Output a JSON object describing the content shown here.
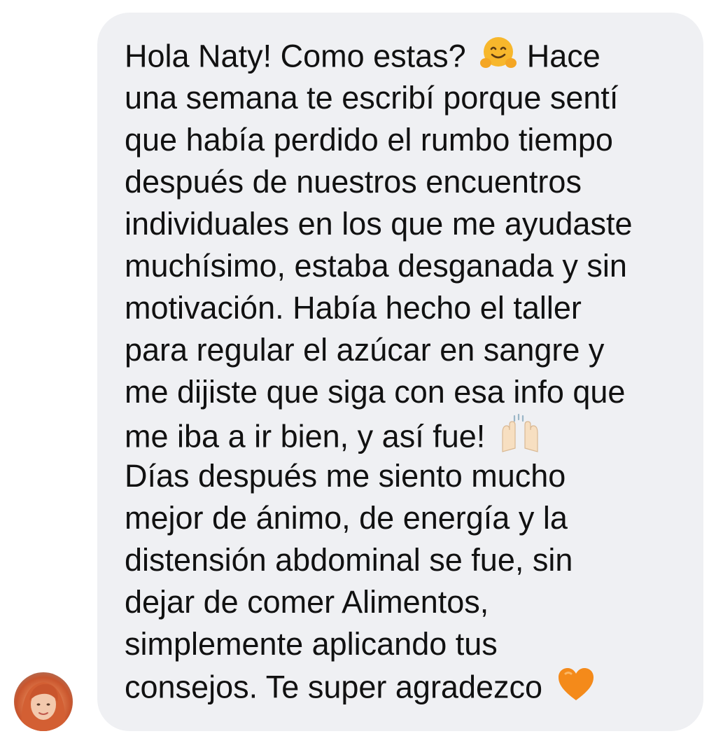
{
  "message": {
    "lines": [
      "Hola Naty! Como estas?",
      "una semana te escribí porque sentí",
      "que había perdido el rumbo tiempo",
      "después de nuestros encuentros",
      "individuales en los que me ayudaste",
      "muchísimo, estaba desganada y sin",
      "motivación. Había hecho el taller",
      "para regular el azúcar en sangre y",
      "me dijiste que siga con esa info que",
      "me iba a ir bien, y así fue!",
      "Días después me siento mucho",
      "mejor de ánimo, de energía y la",
      "distensión abdominal se fue, sin",
      "dejar de comer Alimentos,",
      "simplemente aplicando tus",
      "consejos. Te super agradezco"
    ],
    "line1_tail": "Hace",
    "icons": {
      "hug": "hugging-face-emoji-icon",
      "raised_hands": "raised-hands-emoji-icon",
      "heart": "orange-heart-emoji-icon"
    },
    "colors": {
      "bubble": "#eff0f3",
      "text": "#111111",
      "heart": "#f48a1a",
      "hug_face": "#f7b72c"
    }
  },
  "sender": {
    "avatar_icon": "profile-avatar"
  }
}
